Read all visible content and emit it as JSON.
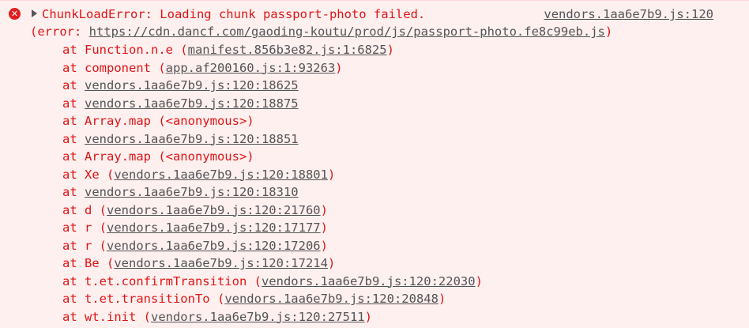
{
  "icon": "error-circle-icon",
  "message": "ChunkLoadError: Loading chunk passport-photo failed.",
  "source_link": "vendors.1aa6e7b9.js:120",
  "error_prefix": "(error: ",
  "error_url": "https://cdn.dancf.com/gaoding-koutu/prod/js/passport-photo.fe8c99eb.js",
  "error_suffix": ")",
  "frames": [
    {
      "pre": "at Function.n.e (",
      "link": "manifest.856b3e82.js:1:6825",
      "post": ")"
    },
    {
      "pre": "at component (",
      "link": "app.af200160.js:1:93263",
      "post": ")"
    },
    {
      "pre": "at ",
      "link": "vendors.1aa6e7b9.js:120:18625",
      "post": ""
    },
    {
      "pre": "at ",
      "link": "vendors.1aa6e7b9.js:120:18875",
      "post": ""
    },
    {
      "pre": "at Array.map (<anonymous>)",
      "link": "",
      "post": ""
    },
    {
      "pre": "at ",
      "link": "vendors.1aa6e7b9.js:120:18851",
      "post": ""
    },
    {
      "pre": "at Array.map (<anonymous>)",
      "link": "",
      "post": ""
    },
    {
      "pre": "at Xe (",
      "link": "vendors.1aa6e7b9.js:120:18801",
      "post": ")"
    },
    {
      "pre": "at ",
      "link": "vendors.1aa6e7b9.js:120:18310",
      "post": ""
    },
    {
      "pre": "at d (",
      "link": "vendors.1aa6e7b9.js:120:21760",
      "post": ")"
    },
    {
      "pre": "at r (",
      "link": "vendors.1aa6e7b9.js:120:17177",
      "post": ")"
    },
    {
      "pre": "at r (",
      "link": "vendors.1aa6e7b9.js:120:17206",
      "post": ")"
    },
    {
      "pre": "at Be (",
      "link": "vendors.1aa6e7b9.js:120:17214",
      "post": ")"
    },
    {
      "pre": "at t.et.confirmTransition (",
      "link": "vendors.1aa6e7b9.js:120:22030",
      "post": ")"
    },
    {
      "pre": "at t.et.transitionTo (",
      "link": "vendors.1aa6e7b9.js:120:20848",
      "post": ")"
    },
    {
      "pre": "at wt.init (",
      "link": "vendors.1aa6e7b9.js:120:27511",
      "post": ")"
    }
  ],
  "colors": {
    "error_text": "#e01414",
    "link_text": "#545454",
    "background": "#fff0f0"
  }
}
